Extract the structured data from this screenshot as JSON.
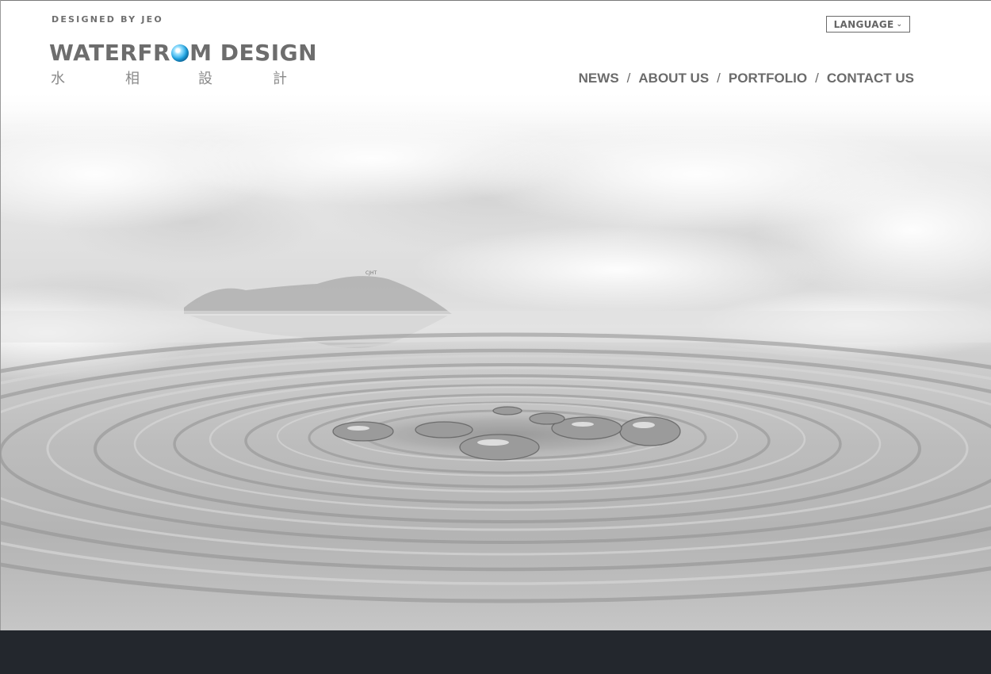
{
  "header": {
    "credit": "DESIGNED BY JEO",
    "logo_prefix": "WATERFR",
    "logo_suffix": "M DESIGN",
    "logo_cjk": [
      "水",
      "相",
      "設",
      "計"
    ],
    "language_label": "LANGUAGE"
  },
  "nav": {
    "items": [
      {
        "label": "NEWS"
      },
      {
        "label": "ABOUT US"
      },
      {
        "label": "PORTFOLIO"
      },
      {
        "label": "CONTACT US"
      }
    ],
    "separator": "/"
  },
  "colors": {
    "text_gray": "#6b6b6b",
    "logo_accent": "#1ea6e6",
    "footer": "#23272d"
  },
  "icons": [
    "globe-icon",
    "chevron-down-icon"
  ]
}
